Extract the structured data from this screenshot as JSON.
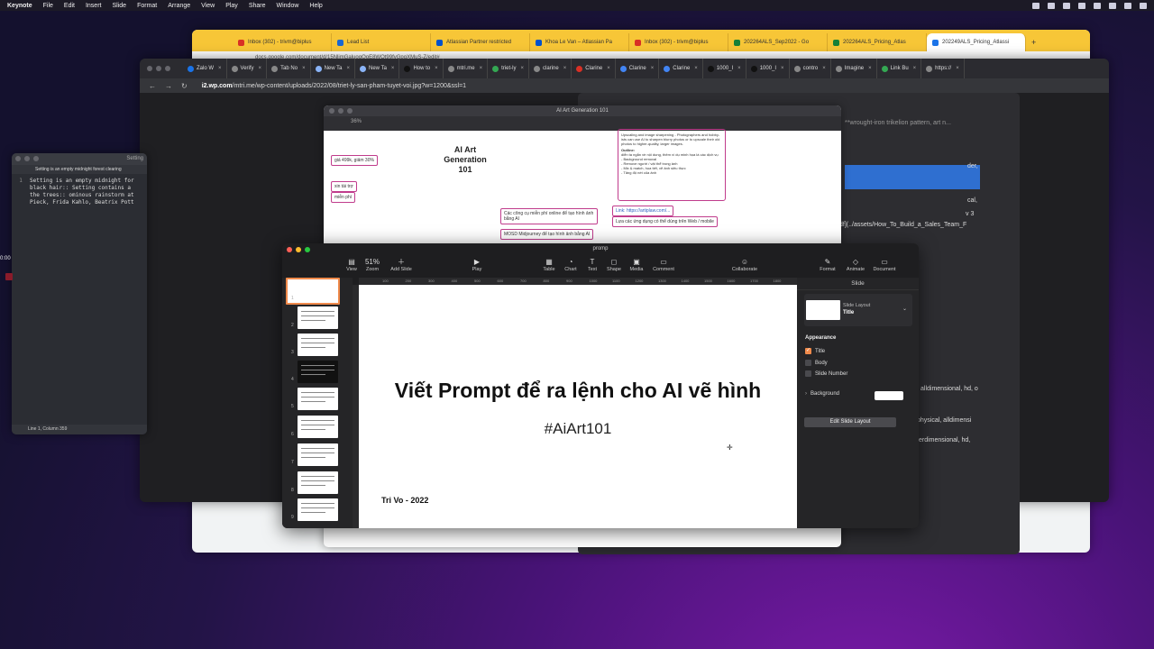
{
  "menubar": {
    "app": "Keynote",
    "items": [
      "File",
      "Edit",
      "Insert",
      "Slide",
      "Format",
      "Arrange",
      "View",
      "Play",
      "Share",
      "Window",
      "Help"
    ]
  },
  "chrome_back": {
    "tabs": [
      {
        "label": "Inbox (302) - trivm@biplus",
        "color": "#d93025"
      },
      {
        "label": "Lead List",
        "color": "#1967d2"
      },
      {
        "label": "Atlassian Partner restricted",
        "color": "#0052cc"
      },
      {
        "label": "Khoa Le Van – Atlassian Pa",
        "color": "#0052cc"
      },
      {
        "label": "Inbox (302) - trivm@biplus",
        "color": "#d93025"
      },
      {
        "label": "202264ALS_Sep2022 - Go",
        "color": "#188038"
      },
      {
        "label": "202264ALS_Pricing_Atlas",
        "color": "#188038"
      },
      {
        "label": "202249ALS_Pricing_Atlassi",
        "color": "#1a73e8"
      }
    ],
    "url": "docs.google.com/document/d/15NljmGaluogQoE8WOt99fvGpgXMuS-Z/edit#"
  },
  "chrome_front": {
    "tabs": [
      "Zalo W",
      "Verify",
      "Tab No",
      "New Ta",
      "New Ta",
      "How to",
      "mtri.me",
      "triet-ly",
      "clarine",
      "Clarine",
      "Clarine",
      "Clarine",
      "1000_I",
      "1000_I",
      "contro",
      "Imagine",
      "Link Bu",
      "https://"
    ],
    "url_host": "i2.wp.com",
    "url_path": "/mtri.me/wp-content/uploads/2022/08/triet-ly-san-pham-tuyet-voi.jpg?w=1200&ssl=1"
  },
  "editor": {
    "title": "Setting",
    "subtitle": "Setting is an empty midnight forest clearing",
    "line_number": "1",
    "lines": [
      "Setting is an empty midnight for",
      "black hair:: Setting contains a",
      "the trees:: ominous rainstorm at",
      "Pieck, Frida Kahlo, Beatrix Pott"
    ],
    "status": "Line 1, Column 359"
  },
  "timer": "0:00",
  "mindmap": {
    "title": "AI Art Generation 101",
    "zoom": "36%",
    "center": [
      "AI Art",
      "Generation",
      "101"
    ],
    "nodes": [
      "giá 499k, giảm 30%",
      "xin tài trợ",
      "miễn phí",
      "Các công cụ miễn phí online để tạo hình ảnh bằng AI",
      "MOSD Midjourney để tạo hình ảnh bằng AI",
      "Lựa các ứng dụng có thể dùng trên Web / mobile"
    ],
    "box_lines": [
      "Upscaling and image sharpening - Photographers and hobby-",
      "ists can use AI to sharpen blurry photos or to upscale their old",
      "photos to higher-quality, larger images.",
      "Outline:",
      "diễn ta ngắn về nội dung, thêm ví dụ minh họa là các dịch vụ",
      "- Background removal",
      "- Remove người / vật thể trong ảnh",
      "- Mix & match, họa tiết, vẽ ảnh siêu thực",
      "- Tăng độ nét của ảnh"
    ],
    "link": "Link: https://artiplaw.com/..."
  },
  "right_panel": {
    "texts": [
      "**wrought-iron trikelion pattern, art n...",
      "der,",
      "cal,",
      "v 3",
      "df](../assets/How_To_Build_a_Sales_Team_F",
      "alldimensional, hd, o",
      "physical, alldimensi",
      "erdimensional, hd,"
    ]
  },
  "keynote": {
    "doc_title": "promp",
    "zoom": "51%",
    "toolbar": [
      {
        "label": "View",
        "glyph": "▤"
      },
      {
        "label": "Zoom",
        "glyph": "51%"
      },
      {
        "label": "Add Slide",
        "glyph": "＋"
      },
      {
        "label": "Play",
        "glyph": "▶"
      },
      {
        "label": "Table",
        "glyph": "▦"
      },
      {
        "label": "Chart",
        "glyph": "◔"
      },
      {
        "label": "Text",
        "glyph": "T"
      },
      {
        "label": "Shape",
        "glyph": "◻"
      },
      {
        "label": "Media",
        "glyph": "▣"
      },
      {
        "label": "Comment",
        "glyph": "▭"
      },
      {
        "label": "Collaborate",
        "glyph": "☺"
      },
      {
        "label": "Format",
        "glyph": "✎"
      },
      {
        "label": "Animate",
        "glyph": "◇"
      },
      {
        "label": "Document",
        "glyph": "▭"
      }
    ],
    "ruler": [
      "100",
      "200",
      "300",
      "400",
      "500",
      "600",
      "700",
      "800",
      "900",
      "1000",
      "1100",
      "1200",
      "1300",
      "1400",
      "1500",
      "1600",
      "1700",
      "1800"
    ],
    "slide_numbers": [
      "1",
      "2",
      "3",
      "4",
      "5",
      "6",
      "7",
      "8",
      "9"
    ],
    "slide": {
      "title": "Viết Prompt để ra lệnh cho AI vẽ hình",
      "subtitle": "#AiArt101",
      "author": "Tri Vo - 2022"
    },
    "inspector": {
      "header": "Slide",
      "layout_label": "Slide Layout",
      "layout_value": "Title",
      "appearance": "Appearance",
      "checks": [
        {
          "label": "Title",
          "checked": true
        },
        {
          "label": "Body",
          "checked": false
        },
        {
          "label": "Slide Number",
          "checked": false
        }
      ],
      "background": "Background",
      "edit_button": "Edit Slide Layout"
    }
  }
}
